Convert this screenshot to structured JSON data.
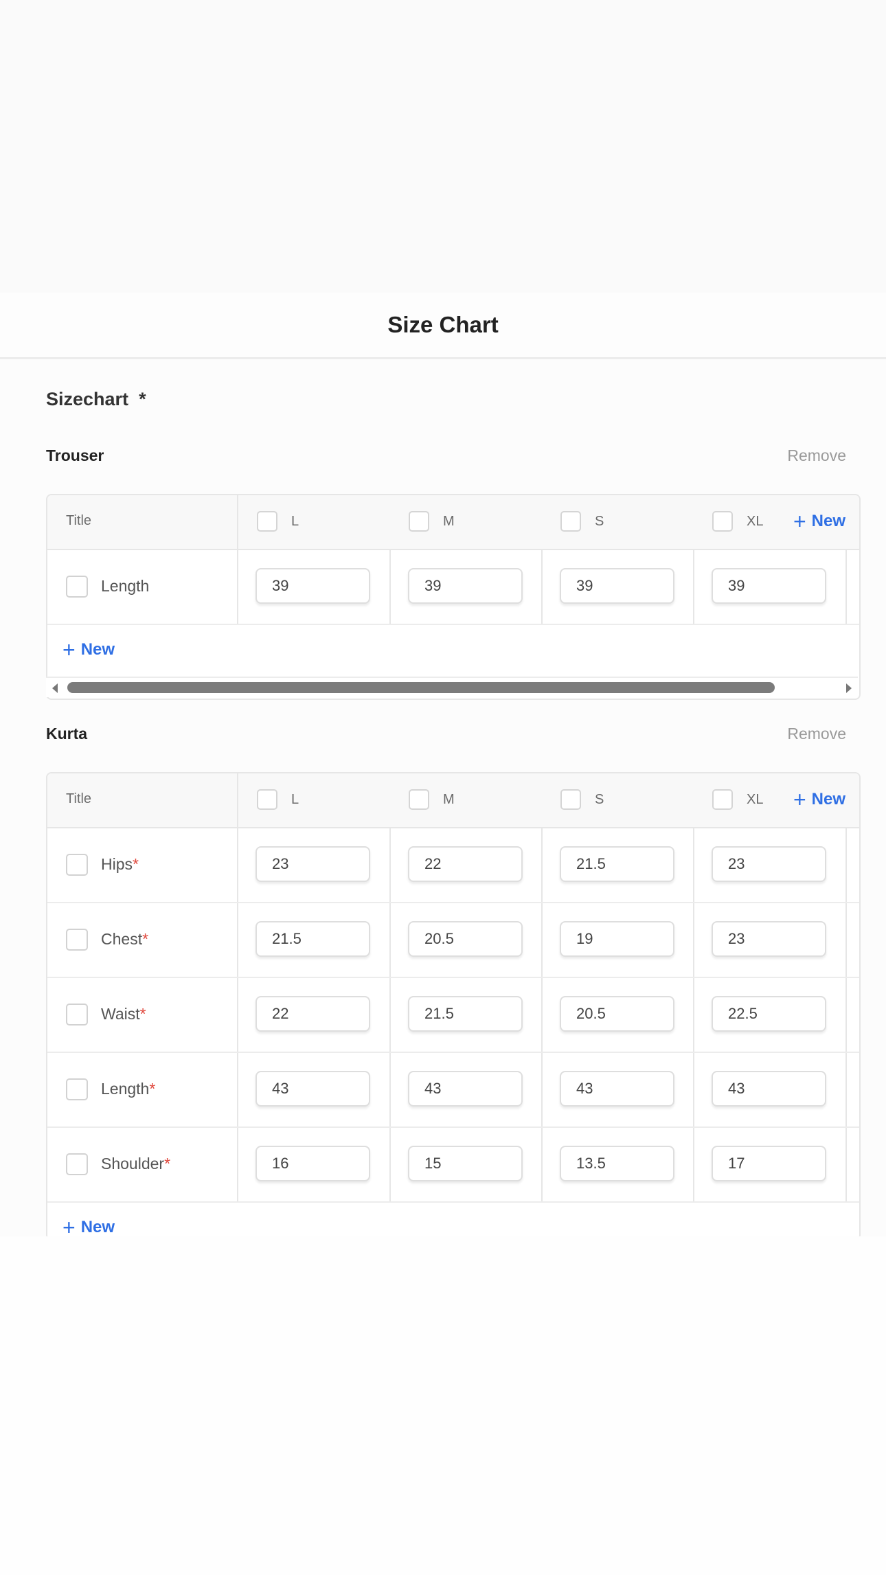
{
  "header": {
    "title": "Size Chart"
  },
  "section": {
    "label": "Sizechart",
    "required_mark": "*"
  },
  "groups": [
    {
      "name": "Trouser",
      "remove_label": "Remove",
      "title_header": "Title",
      "columns": [
        "L",
        "M",
        "S",
        "XL"
      ],
      "new_column_label": "New",
      "rows": [
        {
          "title": "Length",
          "required": false,
          "values": [
            "39",
            "39",
            "39",
            "39"
          ]
        }
      ],
      "new_row_label": "New"
    },
    {
      "name": "Kurta",
      "remove_label": "Remove",
      "title_header": "Title",
      "columns": [
        "L",
        "M",
        "S",
        "XL"
      ],
      "new_column_label": "New",
      "rows": [
        {
          "title": "Hips",
          "required": true,
          "values": [
            "23",
            "22",
            "21.5",
            "23"
          ]
        },
        {
          "title": "Chest",
          "required": true,
          "values": [
            "21.5",
            "20.5",
            "19",
            "23"
          ]
        },
        {
          "title": "Waist",
          "required": true,
          "values": [
            "22",
            "21.5",
            "20.5",
            "22.5"
          ]
        },
        {
          "title": "Length",
          "required": true,
          "values": [
            "43",
            "43",
            "43",
            "43"
          ]
        },
        {
          "title": "Shoulder",
          "required": true,
          "values": [
            "16",
            "15",
            "13.5",
            "17"
          ]
        }
      ],
      "new_row_label": "New"
    }
  ],
  "icons": {
    "plus": "+",
    "required": "*"
  },
  "colors": {
    "accent": "#2f6fe4",
    "required": "#e0473c",
    "muted": "#9a9a9a"
  }
}
